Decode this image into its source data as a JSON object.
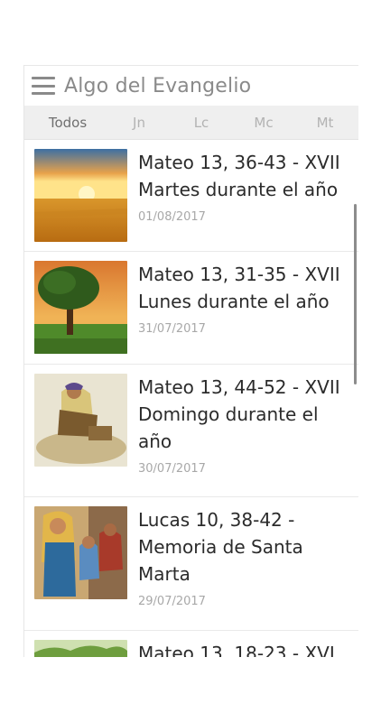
{
  "app": {
    "title": "Algo del Evangelio"
  },
  "tabs": [
    {
      "label": "Todos",
      "active": true
    },
    {
      "label": "Jn",
      "active": false
    },
    {
      "label": "Lc",
      "active": false
    },
    {
      "label": "Mc",
      "active": false
    },
    {
      "label": "Mt",
      "active": false
    }
  ],
  "items": [
    {
      "title": "Mateo 13, 36-43 - XVII Martes durante el año",
      "date": "01/08/2017",
      "image": "wheat-field-sunset"
    },
    {
      "title": "Mateo 13, 31-35 - XVII Lunes durante el año",
      "date": "31/07/2017",
      "image": "tree-sunset"
    },
    {
      "title": "Mateo 13, 44-52 - XVII Domingo durante el año",
      "date": "30/07/2017",
      "image": "man-digging-treasure"
    },
    {
      "title": "Lucas 10, 38-42 - Memoria de Santa Marta",
      "date": "29/07/2017",
      "image": "martha-serving"
    },
    {
      "title": "Mateo 13, 18-23 - XVI",
      "date": "",
      "image": "green-field"
    }
  ],
  "colors": {
    "accent_text": "#8a8a8a",
    "tab_bar": "#efefef"
  }
}
